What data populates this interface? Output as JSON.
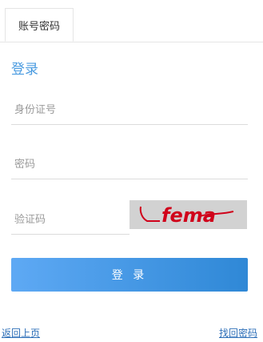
{
  "tabs": [
    {
      "label": "账号密码"
    }
  ],
  "login_title": "登录",
  "form": {
    "id_placeholder": "身份证号",
    "password_placeholder": "密码",
    "code_placeholder": "验证码",
    "captcha_text": "fema",
    "submit_label": "登 录"
  },
  "links": {
    "back": "返回上页",
    "forgot": "找回密码"
  },
  "colors": {
    "accent": "#4a9be0",
    "button_start": "#5ea9f4",
    "button_end": "#2f88d6",
    "captcha_ink": "#d0021b",
    "link": "#2e6fb8"
  }
}
